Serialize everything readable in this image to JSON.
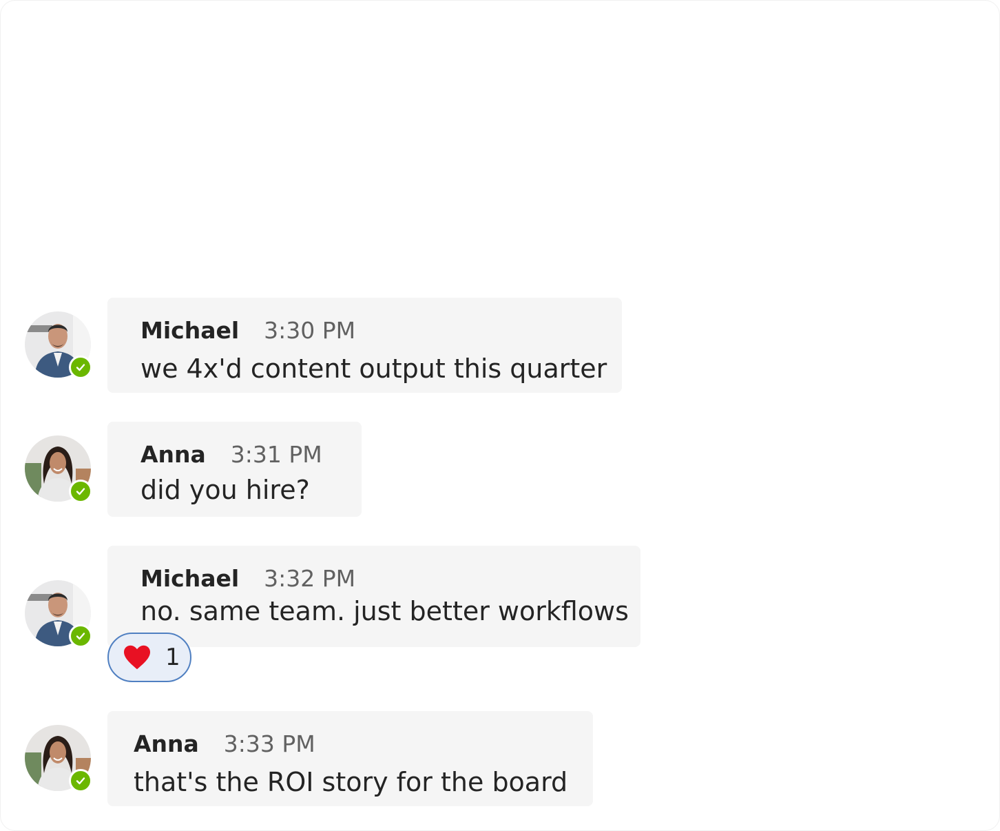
{
  "colors": {
    "bubble_bg": "#f5f5f5",
    "presence_available": "#6bb700",
    "reaction_border": "#4f7fc1",
    "reaction_bg": "#e8eef8",
    "heart": "#e81123"
  },
  "messages": [
    {
      "sender": "Michael",
      "time": "3:30 PM",
      "text": "we 4x'd content output this quarter",
      "avatar_icon": "michael-avatar",
      "presence": "available-icon"
    },
    {
      "sender": "Anna",
      "time": "3:31 PM",
      "text": "did you hire?",
      "avatar_icon": "anna-avatar",
      "presence": "available-icon"
    },
    {
      "sender": "Michael",
      "time": "3:32 PM",
      "text": "no. same team. just better workflows",
      "avatar_icon": "michael-avatar",
      "presence": "available-icon",
      "reaction": {
        "icon": "heart-icon",
        "count": "1"
      }
    },
    {
      "sender": "Anna",
      "time": "3:33 PM",
      "text": "that's the ROI story for the board",
      "avatar_icon": "anna-avatar",
      "presence": "available-icon"
    }
  ]
}
